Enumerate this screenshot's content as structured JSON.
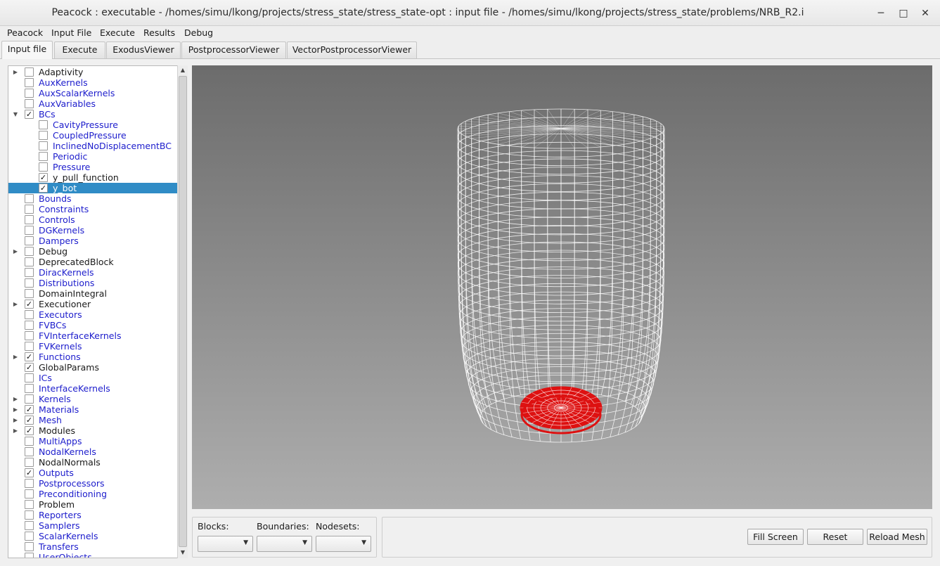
{
  "window": {
    "title": "Peacock : executable - /homes/simu/lkong/projects/stress_state/stress_state-opt : input file - /homes/simu/lkong/projects/stress_state/problems/NRB_R2.i",
    "minimize_glyph": "─",
    "maximize_glyph": "□",
    "close_glyph": "✕"
  },
  "menubar": [
    "Peacock",
    "Input File",
    "Execute",
    "Results",
    "Debug"
  ],
  "tabs": [
    {
      "label": "Input file",
      "active": true
    },
    {
      "label": "Execute",
      "active": false
    },
    {
      "label": "ExodusViewer",
      "active": false
    },
    {
      "label": "PostprocessorViewer",
      "active": false
    },
    {
      "label": "VectorPostprocessorViewer",
      "active": false
    }
  ],
  "tree": [
    {
      "label": "Adaptivity",
      "level": 0,
      "expander": "collapsed",
      "checked": false,
      "color": "black"
    },
    {
      "label": "AuxKernels",
      "level": 0,
      "expander": "none",
      "checked": false,
      "color": "blue"
    },
    {
      "label": "AuxScalarKernels",
      "level": 0,
      "expander": "none",
      "checked": false,
      "color": "blue"
    },
    {
      "label": "AuxVariables",
      "level": 0,
      "expander": "none",
      "checked": false,
      "color": "blue"
    },
    {
      "label": "BCs",
      "level": 0,
      "expander": "expanded",
      "checked": true,
      "color": "blue"
    },
    {
      "label": "CavityPressure",
      "level": 1,
      "expander": "none",
      "checked": false,
      "color": "blue"
    },
    {
      "label": "CoupledPressure",
      "level": 1,
      "expander": "none",
      "checked": false,
      "color": "blue"
    },
    {
      "label": "InclinedNoDisplacementBC",
      "level": 1,
      "expander": "none",
      "checked": false,
      "color": "blue"
    },
    {
      "label": "Periodic",
      "level": 1,
      "expander": "none",
      "checked": false,
      "color": "blue"
    },
    {
      "label": "Pressure",
      "level": 1,
      "expander": "none",
      "checked": false,
      "color": "blue"
    },
    {
      "label": "y_pull_function",
      "level": 1,
      "expander": "none",
      "checked": true,
      "color": "black"
    },
    {
      "label": "y_bot",
      "level": 1,
      "expander": "none",
      "checked": true,
      "color": "black",
      "selected": true
    },
    {
      "label": "Bounds",
      "level": 0,
      "expander": "none",
      "checked": false,
      "color": "blue"
    },
    {
      "label": "Constraints",
      "level": 0,
      "expander": "none",
      "checked": false,
      "color": "blue"
    },
    {
      "label": "Controls",
      "level": 0,
      "expander": "none",
      "checked": false,
      "color": "blue"
    },
    {
      "label": "DGKernels",
      "level": 0,
      "expander": "none",
      "checked": false,
      "color": "blue"
    },
    {
      "label": "Dampers",
      "level": 0,
      "expander": "none",
      "checked": false,
      "color": "blue"
    },
    {
      "label": "Debug",
      "level": 0,
      "expander": "collapsed",
      "checked": false,
      "color": "black"
    },
    {
      "label": "DeprecatedBlock",
      "level": 0,
      "expander": "none",
      "checked": false,
      "color": "black"
    },
    {
      "label": "DiracKernels",
      "level": 0,
      "expander": "none",
      "checked": false,
      "color": "blue"
    },
    {
      "label": "Distributions",
      "level": 0,
      "expander": "none",
      "checked": false,
      "color": "blue"
    },
    {
      "label": "DomainIntegral",
      "level": 0,
      "expander": "none",
      "checked": false,
      "color": "black"
    },
    {
      "label": "Executioner",
      "level": 0,
      "expander": "collapsed",
      "checked": true,
      "color": "black"
    },
    {
      "label": "Executors",
      "level": 0,
      "expander": "none",
      "checked": false,
      "color": "blue"
    },
    {
      "label": "FVBCs",
      "level": 0,
      "expander": "none",
      "checked": false,
      "color": "blue"
    },
    {
      "label": "FVInterfaceKernels",
      "level": 0,
      "expander": "none",
      "checked": false,
      "color": "blue"
    },
    {
      "label": "FVKernels",
      "level": 0,
      "expander": "none",
      "checked": false,
      "color": "blue"
    },
    {
      "label": "Functions",
      "level": 0,
      "expander": "collapsed",
      "checked": true,
      "color": "blue"
    },
    {
      "label": "GlobalParams",
      "level": 0,
      "expander": "none",
      "checked": true,
      "color": "black"
    },
    {
      "label": "ICs",
      "level": 0,
      "expander": "none",
      "checked": false,
      "color": "blue"
    },
    {
      "label": "InterfaceKernels",
      "level": 0,
      "expander": "none",
      "checked": false,
      "color": "blue"
    },
    {
      "label": "Kernels",
      "level": 0,
      "expander": "collapsed",
      "checked": false,
      "color": "blue"
    },
    {
      "label": "Materials",
      "level": 0,
      "expander": "collapsed",
      "checked": true,
      "color": "blue"
    },
    {
      "label": "Mesh",
      "level": 0,
      "expander": "collapsed",
      "checked": true,
      "color": "blue"
    },
    {
      "label": "Modules",
      "level": 0,
      "expander": "collapsed",
      "checked": true,
      "color": "black"
    },
    {
      "label": "MultiApps",
      "level": 0,
      "expander": "none",
      "checked": false,
      "color": "blue"
    },
    {
      "label": "NodalKernels",
      "level": 0,
      "expander": "none",
      "checked": false,
      "color": "blue"
    },
    {
      "label": "NodalNormals",
      "level": 0,
      "expander": "none",
      "checked": false,
      "color": "black"
    },
    {
      "label": "Outputs",
      "level": 0,
      "expander": "none",
      "checked": true,
      "color": "blue"
    },
    {
      "label": "Postprocessors",
      "level": 0,
      "expander": "none",
      "checked": false,
      "color": "blue"
    },
    {
      "label": "Preconditioning",
      "level": 0,
      "expander": "none",
      "checked": false,
      "color": "blue"
    },
    {
      "label": "Problem",
      "level": 0,
      "expander": "none",
      "checked": false,
      "color": "black"
    },
    {
      "label": "Reporters",
      "level": 0,
      "expander": "none",
      "checked": false,
      "color": "blue"
    },
    {
      "label": "Samplers",
      "level": 0,
      "expander": "none",
      "checked": false,
      "color": "blue"
    },
    {
      "label": "ScalarKernels",
      "level": 0,
      "expander": "none",
      "checked": false,
      "color": "blue"
    },
    {
      "label": "Transfers",
      "level": 0,
      "expander": "none",
      "checked": false,
      "color": "blue"
    },
    {
      "label": "UserObjects",
      "level": 0,
      "expander": "none",
      "checked": false,
      "color": "blue"
    }
  ],
  "viewer": {
    "mesh_color": "#ffffff",
    "highlight_color": "#dd1111",
    "background_top": "#6c6c6c",
    "background_bottom": "#aeaeae"
  },
  "filters": {
    "blocks_label": "Blocks:",
    "boundaries_label": "Boundaries:",
    "nodesets_label": "Nodesets:",
    "blocks_value": "",
    "boundaries_value": "",
    "nodesets_value": ""
  },
  "view_buttons": {
    "fill_screen": "Fill Screen",
    "reset": "Reset",
    "reload_mesh": "Reload Mesh"
  },
  "colors": {
    "selection": "#308cc6",
    "link_blue": "#1c1ccc"
  }
}
